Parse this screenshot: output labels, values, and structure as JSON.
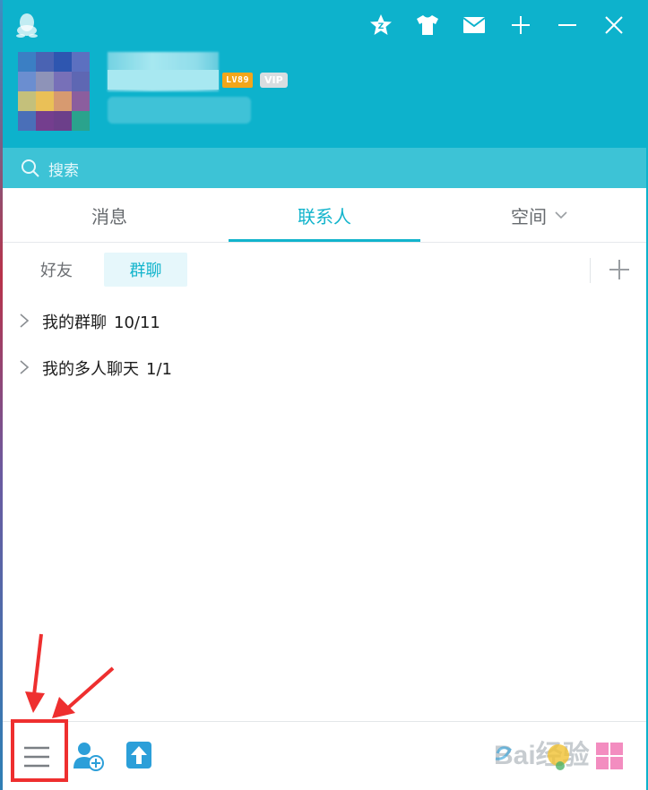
{
  "search": {
    "placeholder": "搜索"
  },
  "profile": {
    "level_badge": "LV89",
    "vip_badge": "VIP"
  },
  "main_tabs": [
    {
      "label": "消息",
      "active": false
    },
    {
      "label": "联系人",
      "active": true
    },
    {
      "label": "空间",
      "active": false,
      "has_dropdown": true
    }
  ],
  "sub_tabs": [
    {
      "label": "好友",
      "active": false
    },
    {
      "label": "群聊",
      "active": true
    }
  ],
  "groups": [
    {
      "label": "我的群聊",
      "count": "10/11"
    },
    {
      "label": "我的多人聊天",
      "count": "1/1"
    }
  ],
  "header_icons": [
    "qq-penguin-icon",
    "star-icon",
    "shirt-icon",
    "mail-icon",
    "plus-icon",
    "minimize-icon",
    "close-icon"
  ],
  "bottom_icons": [
    "menu-icon",
    "add-contact-icon",
    "upload-icon"
  ],
  "watermark": "Bai经验",
  "colors": {
    "brand": "#0db2cc",
    "search_bar": "#3dc3d6",
    "active_tab": "#12b4cc",
    "annotation": "#ee2f2f"
  }
}
